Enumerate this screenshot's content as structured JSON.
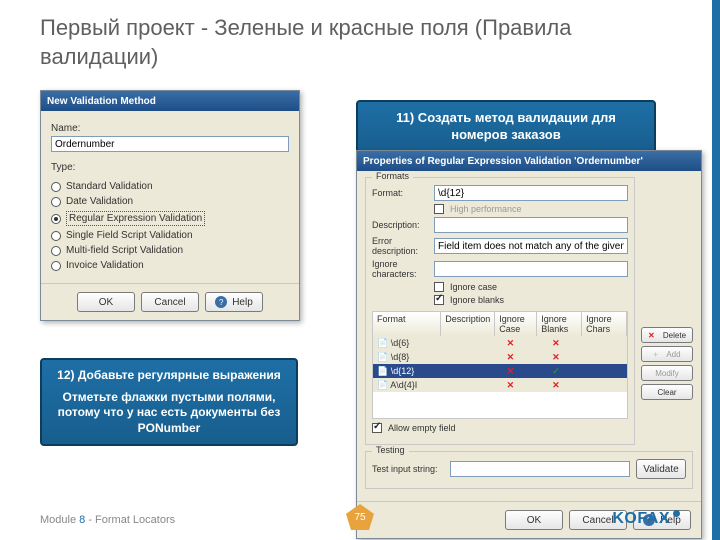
{
  "slide": {
    "title": "Первый проект - Зеленые и красные поля (Правила валидации)"
  },
  "dialog1": {
    "title": "New Validation Method",
    "name_label": "Name:",
    "name_value": "Ordernumber",
    "type_label": "Type:",
    "radios": {
      "r0": "Standard Validation",
      "r1": "Date Validation",
      "r2": "Regular Expression Validation",
      "r3": "Single Field Script Validation",
      "r4": "Multi-field Script Validation",
      "r5": "Invoice Validation"
    },
    "buttons": {
      "ok": "OK",
      "cancel": "Cancel",
      "help": "Help"
    }
  },
  "dialog2": {
    "title": "Properties of Regular Expression Validation 'Ordernumber'",
    "grp_formats": "Formats",
    "format_label": "Format:",
    "format_value": "\\d{12}",
    "hp": "High performance",
    "desc_label": "Description:",
    "errdesc_label": "Error description:",
    "errdesc_value": "Field item does not match any of the given expressions.",
    "ignchars_label": "Ignore characters:",
    "igncase": "Ignore case",
    "ignblanks": "Ignore blanks",
    "side": {
      "delete": "Delete",
      "add": "Add",
      "modify": "Modify",
      "clear": "Clear"
    },
    "cols": {
      "c1": "Format",
      "c2": "Description",
      "c3": "Ignore Case",
      "c4": "Ignore Blanks",
      "c5": "Ignore Chars"
    },
    "rows": {
      "r0": {
        "fmt": "📄 \\d{6}"
      },
      "r1": {
        "fmt": "📄 \\d{8}"
      },
      "r2": {
        "fmt": "📄 \\d{12}"
      },
      "r3": {
        "fmt": "📄 A\\d{4}I"
      }
    },
    "allow_empty": "Allow empty field",
    "grp_testing": "Testing",
    "test_label": "Test input string:",
    "validate": "Validate",
    "buttons": {
      "ok": "OK",
      "cancel": "Cancel",
      "help": "Help"
    }
  },
  "callouts": {
    "c11": "11) Создать метод валидации для номеров заказов",
    "c12a": "12) Добавьте регулярные выражения",
    "c12b": "Отметьте флажки пустыми полями, потому что у нас есть документы без PONumber"
  },
  "footer": {
    "module": "Module ",
    "mod_no": "8",
    "rest": " - Format Locators",
    "page": "75",
    "brand": "KOFAX"
  }
}
